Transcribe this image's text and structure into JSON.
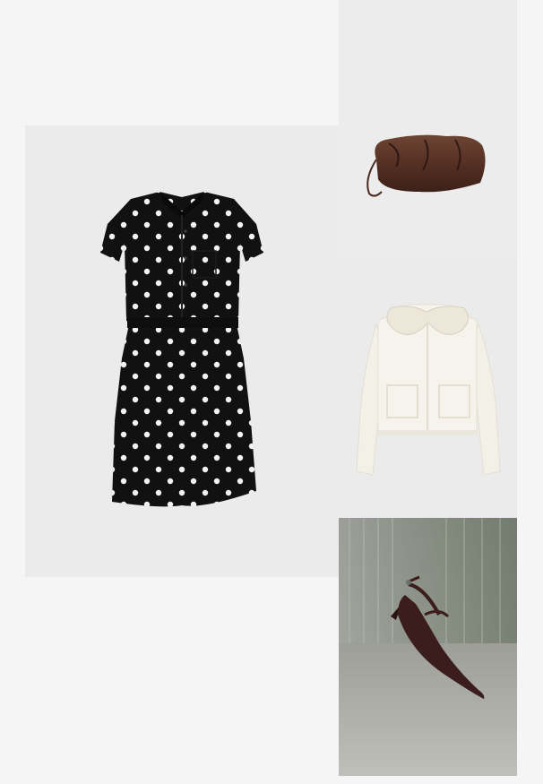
{
  "layout": {
    "background": "#f5f5f5"
  },
  "items": [
    {
      "name": "polka-dot-shirt-dress",
      "description_icon": "dress-image",
      "colors": [
        "#101010",
        "#f2f2f2"
      ]
    },
    {
      "name": "brown-pouch-bag",
      "description_icon": "bag-image",
      "colors": [
        "#4e2c22",
        "#6b4030"
      ]
    },
    {
      "name": "cream-collared-jacket",
      "description_icon": "jacket-image",
      "colors": [
        "#f4f1ea",
        "#ece6da"
      ]
    },
    {
      "name": "burgundy-slingback-heel",
      "description_icon": "shoe-image",
      "colors": [
        "#3a1c1c",
        "#8d8f89"
      ]
    }
  ]
}
